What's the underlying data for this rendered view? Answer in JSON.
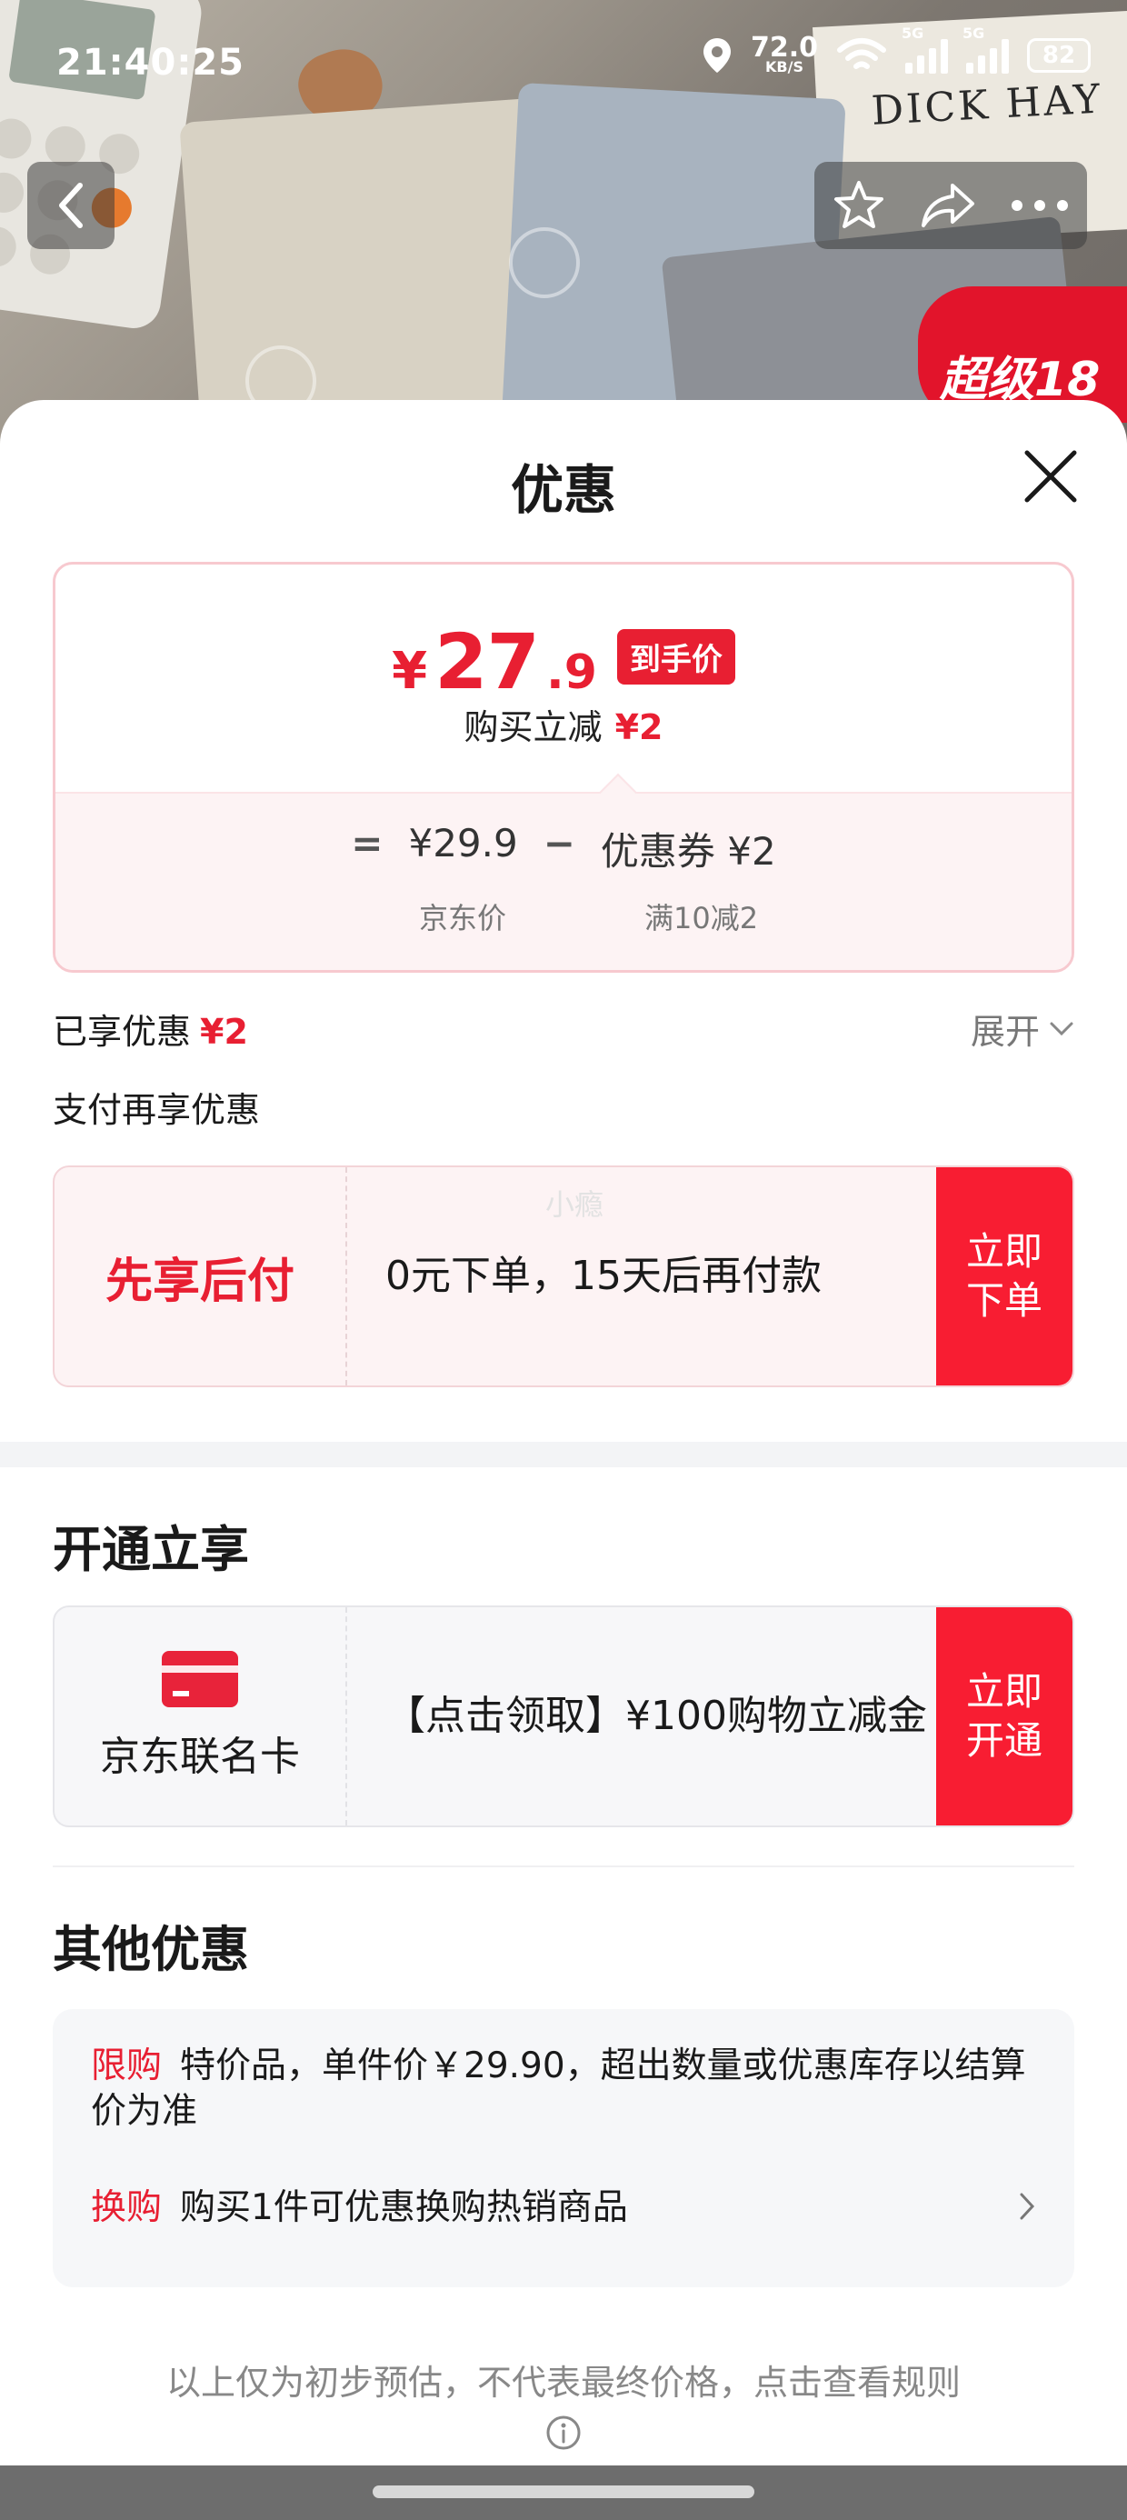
{
  "status_bar": {
    "time": "21:40:25",
    "speed_value": "72.0",
    "speed_unit": "KB/S",
    "network_1": "5G",
    "network_2": "5G",
    "battery": "82"
  },
  "background": {
    "book_text": "DICK HAY",
    "promo_text": "超级18"
  },
  "sheet": {
    "title": "优惠"
  },
  "price_card": {
    "currency": "¥",
    "price_integer": "27",
    "price_decimal": ".9",
    "price_tag": "到手价",
    "subtitle": "购买立减",
    "subtitle_amount": "¥2",
    "equals": "=",
    "base_price": "¥29.9",
    "minus": "−",
    "coupon": "优惠券 ¥2",
    "base_price_label": "京东价",
    "coupon_label": "满10减2"
  },
  "enjoyed": {
    "label": "已享优惠",
    "amount": "¥2",
    "expand": "展开"
  },
  "pay_more": {
    "title": "支付再享优惠",
    "offer_left": "先享后付",
    "watermark": "小瘾",
    "offer_text": "0元下单，15天后再付款",
    "button": "立即\n下单"
  },
  "open_section": {
    "title": "开通立享",
    "card_name": "京东联名卡",
    "offer_text": "【点击领取】¥100购物立减金",
    "button": "立即\n开通"
  },
  "other_section": {
    "title": "其他优惠",
    "rows": [
      {
        "label": "限购",
        "text": "特价品，单件价￥29.90，超出数量或优惠库存以结算价为准"
      },
      {
        "label": "换购",
        "text": "购买1件可优惠换购热销商品"
      }
    ]
  },
  "disclaimer": "以上仅为初步预估，不代表最终价格，点击查看规则",
  "colors": {
    "accent_red": "#e81f32",
    "button_red": "#f81d32"
  }
}
